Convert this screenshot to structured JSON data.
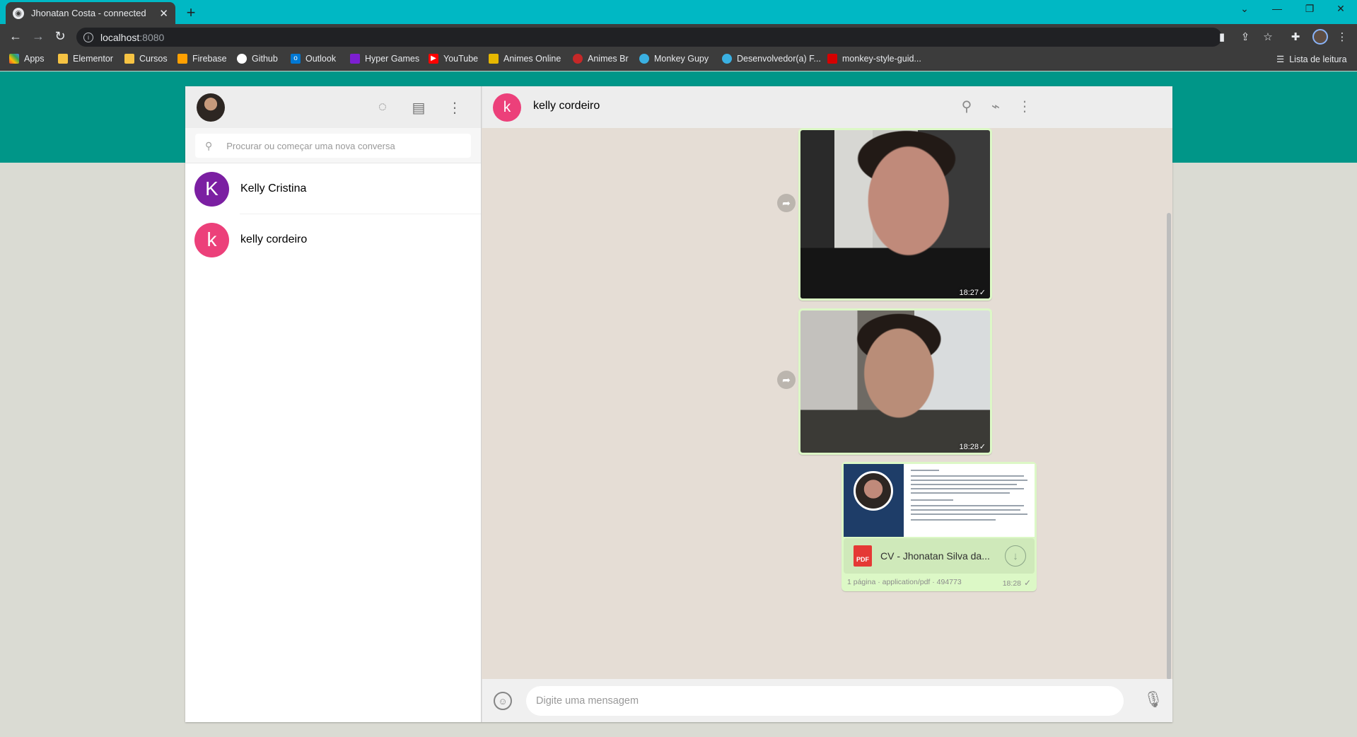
{
  "browser": {
    "tab_title": "Jhonatan Costa - connected",
    "tab_close": "✕",
    "new_tab": "+",
    "url_host": "localhost",
    "url_port": ":8080",
    "bookmarks": [
      "Apps",
      "Elementor",
      "Cursos",
      "Firebase",
      "Github",
      "Outlook",
      "Hyper Games",
      "YouTube",
      "Animes Online",
      "Animes Br",
      "Monkey Gupy",
      "Desenvolvedor(a) F...",
      "monkey-style-guid..."
    ],
    "reading_list": "Lista de leitura"
  },
  "sidebar": {
    "search_placeholder": "Procurar ou começar uma nova conversa",
    "contacts": [
      {
        "initial": "K",
        "name": "Kelly Cristina",
        "color": "#7b1fa2"
      },
      {
        "initial": "k",
        "name": "kelly cordeiro",
        "color": "#ec407a"
      }
    ]
  },
  "chat": {
    "contact_initial": "k",
    "contact_name": "kelly cordeiro",
    "contact_color": "#ec407a",
    "messages": [
      {
        "type": "image",
        "time": "18:27",
        "status": "✓"
      },
      {
        "type": "image",
        "time": "18:28",
        "status": "✓"
      },
      {
        "type": "document",
        "file_name": "CV - Jhonatan Silva da...",
        "meta": "1 página · application/pdf · 494773",
        "time": "18:28",
        "status": "✓",
        "icon_label": "PDF"
      }
    ],
    "compose_placeholder": "Digite uma mensagem"
  },
  "colors": {
    "band": "#009688",
    "outgoing_bubble": "#dcf8c6",
    "chat_background": "#e5ddd5"
  }
}
